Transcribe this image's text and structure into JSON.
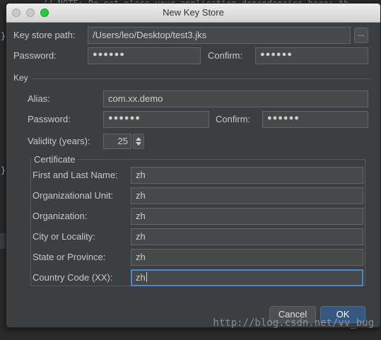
{
  "background": {
    "code_comment": "// NOTE: Do not place your application dependencies here; th"
  },
  "window": {
    "title": "New Key Store"
  },
  "keystore": {
    "path_label": "Key store path:",
    "path_value": "/Users/leo/Desktop/test3.jks",
    "browse_label": "...",
    "password_label": "Password:",
    "password_value": "●●●●●●",
    "confirm_label": "Confirm:",
    "confirm_value": "●●●●●●"
  },
  "key": {
    "section_label": "Key",
    "alias_label": "Alias:",
    "alias_value": "com.xx.demo",
    "password_label": "Password:",
    "password_value": "●●●●●●",
    "confirm_label": "Confirm:",
    "confirm_value": "●●●●●●",
    "validity_label": "Validity (years):",
    "validity_value": "25"
  },
  "certificate": {
    "legend": "Certificate",
    "fields": [
      {
        "label": "First and Last Name:",
        "value": "zh"
      },
      {
        "label": "Organizational Unit:",
        "value": "zh"
      },
      {
        "label": "Organization:",
        "value": "zh"
      },
      {
        "label": "City or Locality:",
        "value": "zh"
      },
      {
        "label": "State or Province:",
        "value": "zh"
      },
      {
        "label": "Country Code (XX):",
        "value": "zh"
      }
    ]
  },
  "buttons": {
    "cancel": "Cancel",
    "ok": "OK"
  },
  "watermark": "http://blog.csdn.net/vv_bug",
  "colors": {
    "dialog_bg": "#3c3f41",
    "field_bg": "#45494a",
    "focus_border": "#4a88c7",
    "ok_button": "#365880"
  }
}
